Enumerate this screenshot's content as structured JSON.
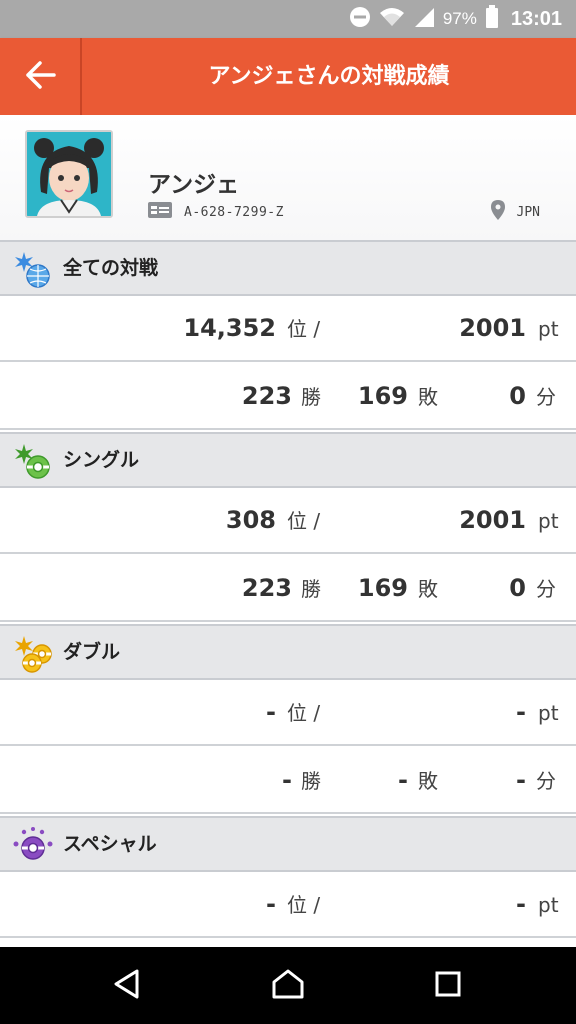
{
  "status_bar": {
    "battery_percent": "97%",
    "time": "13:01",
    "icons": [
      "dnd-icon",
      "wifi-icon",
      "signal-icon",
      "battery-icon"
    ]
  },
  "header": {
    "title": "アンジェさんの対戦成績",
    "back_icon": "arrow-left-icon",
    "color": "#ea5a35"
  },
  "profile": {
    "name": "アンジェ",
    "id": "A-628-7299-Z",
    "region": "JPN"
  },
  "sections": [
    {
      "label": "全ての対戦",
      "icon": "globe-icon",
      "rank": "14,352",
      "rank_unit": "位 /",
      "points": "2001",
      "points_unit": "pt",
      "wins": "223",
      "wins_unit": "勝",
      "losses": "169",
      "losses_unit": "敗",
      "draws": "0",
      "draws_unit": "分"
    },
    {
      "label": "シングル",
      "icon": "single-battle-icon",
      "rank": "308",
      "rank_unit": "位 /",
      "points": "2001",
      "points_unit": "pt",
      "wins": "223",
      "wins_unit": "勝",
      "losses": "169",
      "losses_unit": "敗",
      "draws": "0",
      "draws_unit": "分"
    },
    {
      "label": "ダブル",
      "icon": "double-battle-icon",
      "rank": "-",
      "rank_unit": "位 /",
      "points": "-",
      "points_unit": "pt",
      "wins": "-",
      "wins_unit": "勝",
      "losses": "-",
      "losses_unit": "敗",
      "draws": "-",
      "draws_unit": "分"
    },
    {
      "label": "スペシャル",
      "icon": "special-battle-icon",
      "rank": "-",
      "rank_unit": "位 /",
      "points": "-",
      "points_unit": "pt"
    }
  ],
  "nav": {
    "back_icon": "nav-back-icon",
    "home_icon": "nav-home-icon",
    "recents_icon": "nav-recents-icon"
  }
}
